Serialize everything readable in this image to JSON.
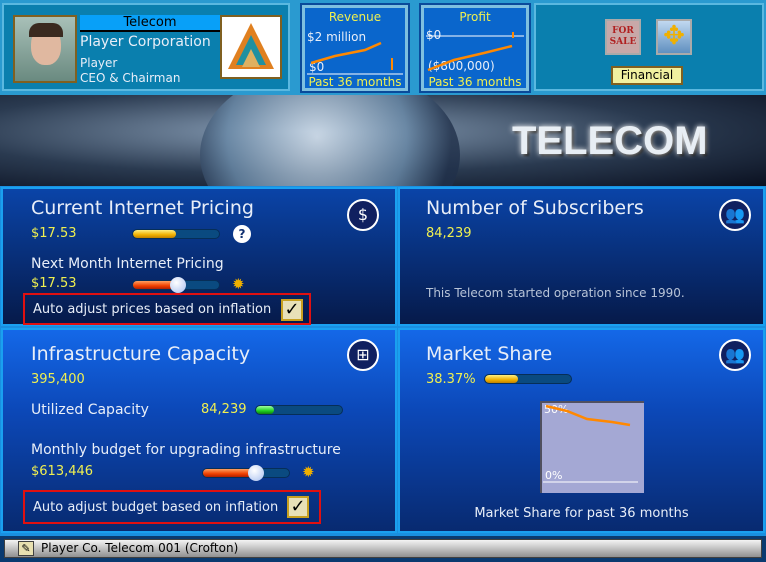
{
  "header": {
    "company_type": "Telecom",
    "corporation": "Player Corporation",
    "player": "Player",
    "title": "CEO & Chairman"
  },
  "revenue": {
    "title": "Revenue",
    "top_label": "$2 million",
    "bottom_label": "$0",
    "footer": "Past 36 months"
  },
  "profit": {
    "title": "Profit",
    "top_label": "$0",
    "bottom_label": "($800,000)",
    "footer": "Past 36 months"
  },
  "actions": {
    "for_sale_icon": "for-sale-sign-icon",
    "move_icon": "move-arrows-icon",
    "financial_label": "Financial"
  },
  "banner": {
    "title": "TELECOM"
  },
  "pricing": {
    "title": "Current Internet Pricing",
    "current": "$17.53",
    "current_level": 0.5,
    "next_title": "Next Month Internet Pricing",
    "next": "$17.53",
    "next_level": 0.5,
    "auto_label": "Auto adjust prices based on inflation",
    "auto_checked": true
  },
  "subscribers": {
    "title": "Number of Subscribers",
    "count": "84,239",
    "note": "This Telecom started operation since 1990."
  },
  "infrastructure": {
    "title": "Infrastructure Capacity",
    "capacity": "395,400",
    "utilized_label": "Utilized Capacity",
    "utilized": "84,239",
    "utilized_level": 0.21,
    "budget_label": "Monthly budget for upgrading infrastructure",
    "budget": "$613,446",
    "budget_level": 0.6,
    "auto_label": "Auto adjust budget based on inflation",
    "auto_checked": true
  },
  "market_share": {
    "title": "Market Share",
    "value": "38.37%",
    "level": 0.3837,
    "chart_top": "50%",
    "chart_bottom": "0%",
    "caption": "Market Share for past 36 months"
  },
  "status_bar": {
    "text": "Player Co. Telecom 001 (Crofton)"
  },
  "colors": {
    "accent_yellow": "#f0f050",
    "chart_line": "#ff8800",
    "highlight_red": "#e01010"
  }
}
